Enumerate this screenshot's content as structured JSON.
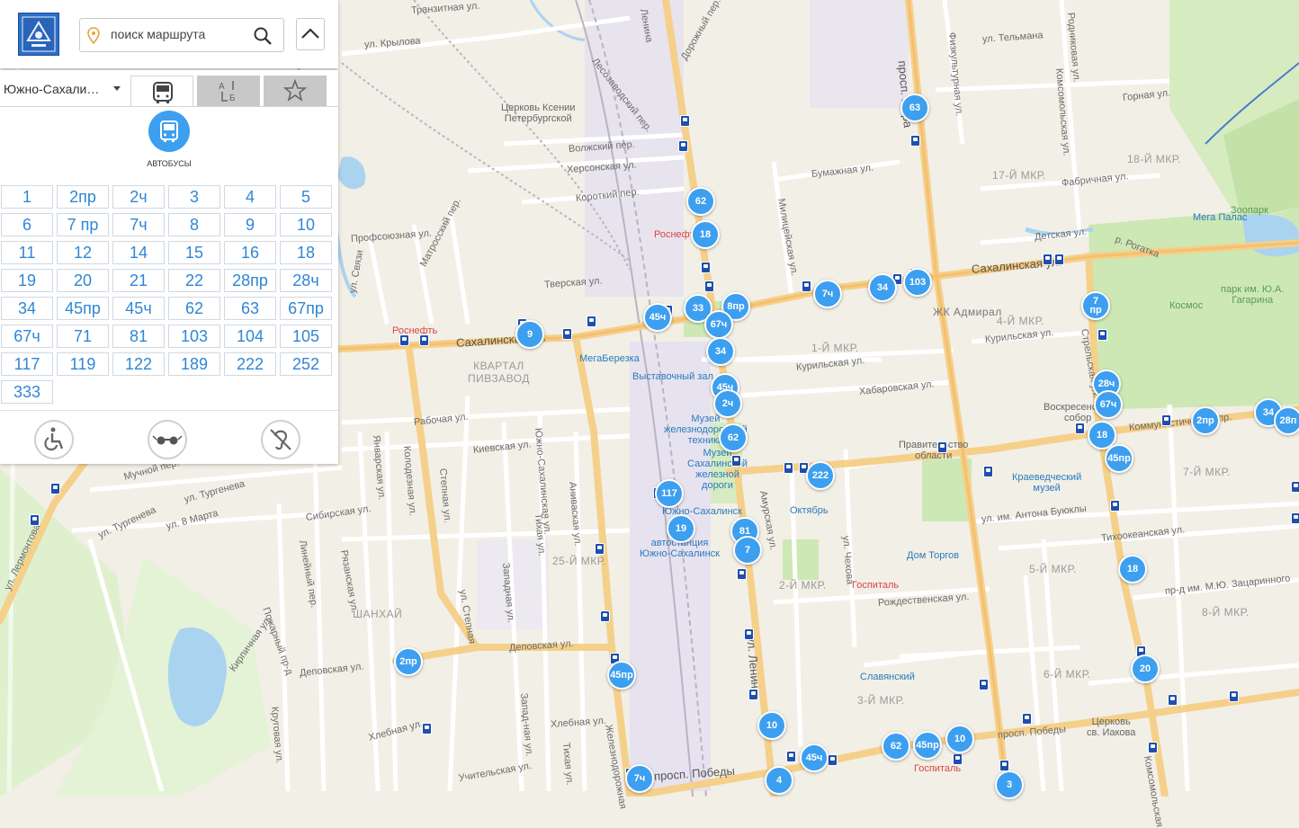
{
  "search": {
    "placeholder": "поиск маршрута"
  },
  "panel": {
    "city": "Южно-Сахали…",
    "tabs": [
      "bus-icon",
      "ab-icon",
      "star-icon"
    ],
    "transport_type_label": "АВТОБУСЫ",
    "routes": [
      "1",
      "2пр",
      "2ч",
      "3",
      "4",
      "5",
      "6",
      "7 пр",
      "7ч",
      "8",
      "9",
      "10",
      "11",
      "12",
      "14",
      "15",
      "16",
      "18",
      "19",
      "20",
      "21",
      "22",
      "28пр",
      "28ч",
      "34",
      "45пр",
      "45ч",
      "62",
      "63",
      "67пр",
      "67ч",
      "71",
      "81",
      "103",
      "104",
      "105",
      "117",
      "119",
      "122",
      "189",
      "222",
      "252",
      "333"
    ],
    "accessibility": [
      "wheelchair-icon",
      "low-vision-icon",
      "hearing-impaired-icon"
    ]
  },
  "colors": {
    "accent": "#3d9ff0",
    "route_text": "#2f86d6",
    "stop": "#1e4fb0",
    "main_road": "#f5c77e",
    "park": "#cde8b4"
  },
  "map": {
    "streets": [
      "Транзитная ул.",
      "ул. Крылова",
      "Лесозаводский пер.",
      "Дорожный пер.",
      "Ленина",
      "Волжский пер.",
      "Херсонская ул.",
      "Короткий пер.",
      "Бумажная ул.",
      "Милицейская ул.",
      "Физкультурная ул.",
      "ул. Тельмана",
      "Родниковая ул.",
      "Комсомольская ул.",
      "Горная ул.",
      "Фабричная ул.",
      "Детская ул.",
      "Сахалинская ул.",
      "Сахалинская ул.",
      "просп. Мира",
      "Курильская ул.",
      "Курильская ул.",
      "Хабаровская ул.",
      "Профсоюзная ул.",
      "Тверская ул.",
      "Матросский пер.",
      "ул. Связи",
      "Рабочая ул.",
      "Киевская ул.",
      "Январская ул.",
      "Колодезная ул.",
      "Степная ул.",
      "Южно-Сахалинская ул.",
      "Аниваская ул.",
      "Тихая ул.",
      "Мучной пер.",
      "ул. Тургенева",
      "ул. Тургенева",
      "ул. 8 Марта",
      "Сибирская ул.",
      "Линейный пер.",
      "Рязанская ул.",
      "Западная ул.",
      "ул. Лермонтова",
      "Пожарный пр-д",
      "Кирпичная ул.",
      "Деповская ул.",
      "Деповская ул.",
      "Хлебная ул.",
      "Хлебная ул.",
      "Круговая ул.",
      "Учительская ул.",
      "Тихая ул.",
      "Запад-ная ул.",
      "Железнодорожная",
      "просп. Победы",
      "просп. Победы",
      "ул. Ленина",
      "Амурская ул.",
      "ул. Чехова",
      "Рождественская ул.",
      "ул. им. Антона Буюклы",
      "Тихоокеанская ул.",
      "пр-д им. М.Ю. Зацаринного",
      "Коммунистический пр.",
      "Комсомольская",
      "р. Рогатка",
      "Стрельская ул.",
      "ул. Степная"
    ],
    "districts": [
      "17-Й МКР.",
      "18-Й МКР.",
      "4-Й МКР.",
      "1-Й МКР.",
      "7-Й МКР.",
      "5-Й МКР.",
      "8-Й МКР.",
      "6-Й МКР.",
      "3-Й МКР.",
      "2-Й МКР.",
      "25-Й МКР.",
      "ШАНХАЙ",
      "КВАРТАЛ\nПИВЗАВОД",
      "ЖК Адмирал"
    ],
    "pois": [
      "Церковь Ксении\nПетербургской",
      "Роснефть",
      "Роснефть",
      "МегаБерезка",
      "Выставочный зал",
      "Музей\nжелезнодорожной\nтехники",
      "Музей\nСахалинской\nжелезной\nдороги",
      "Южно-Сахалинск",
      "автостанция\nЮжно-Сахалинск",
      "Октябрь",
      "Правительство\nобласти",
      "Краеведческий\nмузей",
      "Дом Торгов",
      "Госпиталь",
      "Госпиталь",
      "Славянский",
      "Церковь\nсв. Иакова",
      "Мега Палас",
      "Зоопарк",
      "Космос",
      "парк им. Ю.А.\nГагарина",
      "Воскресенский\nсобор"
    ],
    "markers": [
      "63",
      "62",
      "18",
      "34",
      "103",
      "7ч",
      "33",
      "8пр",
      "67ч",
      "45ч",
      "34",
      "9",
      "45ч",
      "2ч",
      "62",
      "222",
      "117",
      "19",
      "81",
      "7",
      "2пр",
      "45пр",
      "7ч",
      "10",
      "4",
      "45ч",
      "62",
      "45пр",
      "10",
      "3",
      "7\nпр",
      "28ч",
      "67ч",
      "18",
      "45пр",
      "2пр",
      "34",
      "28п",
      "18",
      "20"
    ]
  }
}
